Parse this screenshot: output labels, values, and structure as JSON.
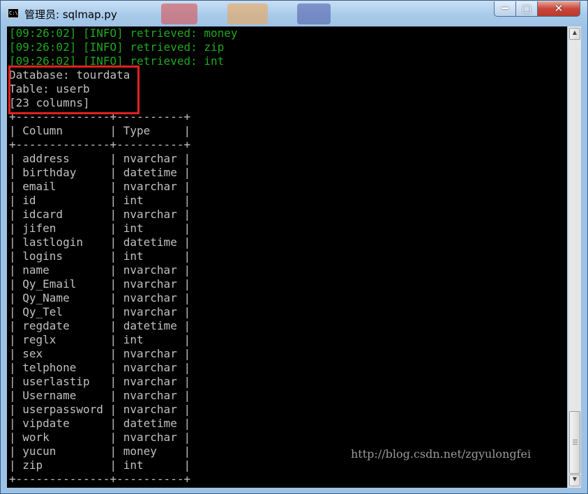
{
  "window": {
    "title": "管理员: sqlmap.py",
    "icon_label": "C:\\",
    "icon": "console-window-icon",
    "controls": {
      "minimize": "━",
      "maximize": "▢",
      "close": "✕"
    }
  },
  "colors": {
    "info_text": "#1fa81f",
    "normal_text": "#c0c0c0",
    "highlight_box": "#e22020",
    "background": "#000000"
  },
  "console": {
    "log_lines": [
      "[09:26:02] [INFO] retrieved: money",
      "[09:26:02] [INFO] retrieved: zip",
      "[09:26:02] [INFO] retrieved: int"
    ],
    "database_line": "Database: tourdata",
    "table_line": "Table: userb",
    "columns_count_line": "[23 columns]",
    "border_line": "+--------------+----------+",
    "header_line": "| Column       | Type     |",
    "rows": [
      "| address      | nvarchar |",
      "| birthday     | datetime |",
      "| email        | nvarchar |",
      "| id           | int      |",
      "| idcard       | nvarchar |",
      "| jifen        | int      |",
      "| lastlogin    | datetime |",
      "| logins       | int      |",
      "| name         | nvarchar |",
      "| Qy_Email     | nvarchar |",
      "| Qy_Name      | nvarchar |",
      "| Qy_Tel       | nvarchar |",
      "| regdate      | datetime |",
      "| reglx        | int      |",
      "| sex          | nvarchar |",
      "| telphone     | nvarchar |",
      "| userlastip   | nvarchar |",
      "| Username     | nvarchar |",
      "| userpassword | nvarchar |",
      "| vipdate      | datetime |",
      "| work         | nvarchar |",
      "| yucun        | money    |",
      "| zip          | int      |"
    ]
  },
  "watermark": "http://blog.csdn.net/zgyulongfei",
  "scrollbar": {
    "up_arrow": "▲",
    "down_arrow": "▼"
  }
}
